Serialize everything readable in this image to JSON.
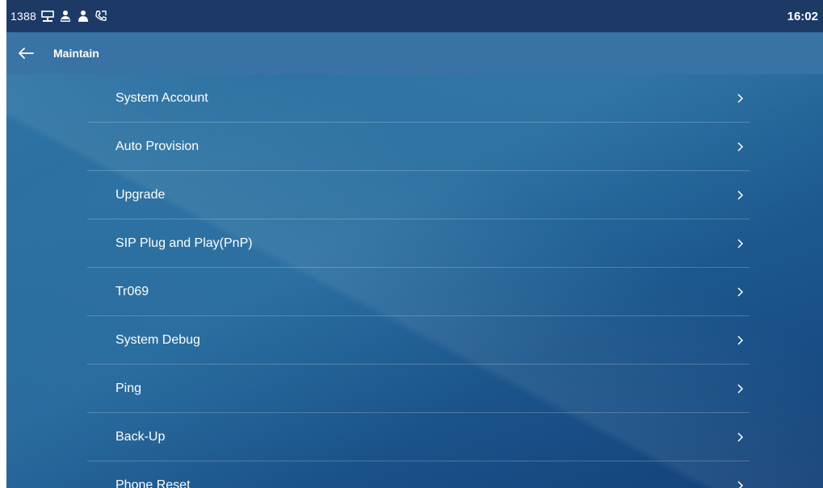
{
  "status_bar": {
    "extension": "1388",
    "time": "16:02",
    "icons": [
      "network-icon",
      "contacts-icon",
      "user-icon",
      "call-forward-icon"
    ]
  },
  "title_bar": {
    "title": "Maintain",
    "back_icon": "back-arrow-icon"
  },
  "menu": {
    "items": [
      {
        "label": "System Account"
      },
      {
        "label": "Auto Provision"
      },
      {
        "label": "Upgrade"
      },
      {
        "label": "SIP Plug and Play(PnP)"
      },
      {
        "label": "Tr069"
      },
      {
        "label": "System Debug"
      },
      {
        "label": "Ping"
      },
      {
        "label": "Back-Up"
      },
      {
        "label": "Phone Reset"
      }
    ],
    "chevron_icon": "chevron-right-icon"
  },
  "colors": {
    "status_bar_bg": "#1d3a66",
    "title_bar_bg": "#3a73a5",
    "background_top": "#2f76a8",
    "background_bottom": "#134078",
    "text": "#ffffff"
  }
}
